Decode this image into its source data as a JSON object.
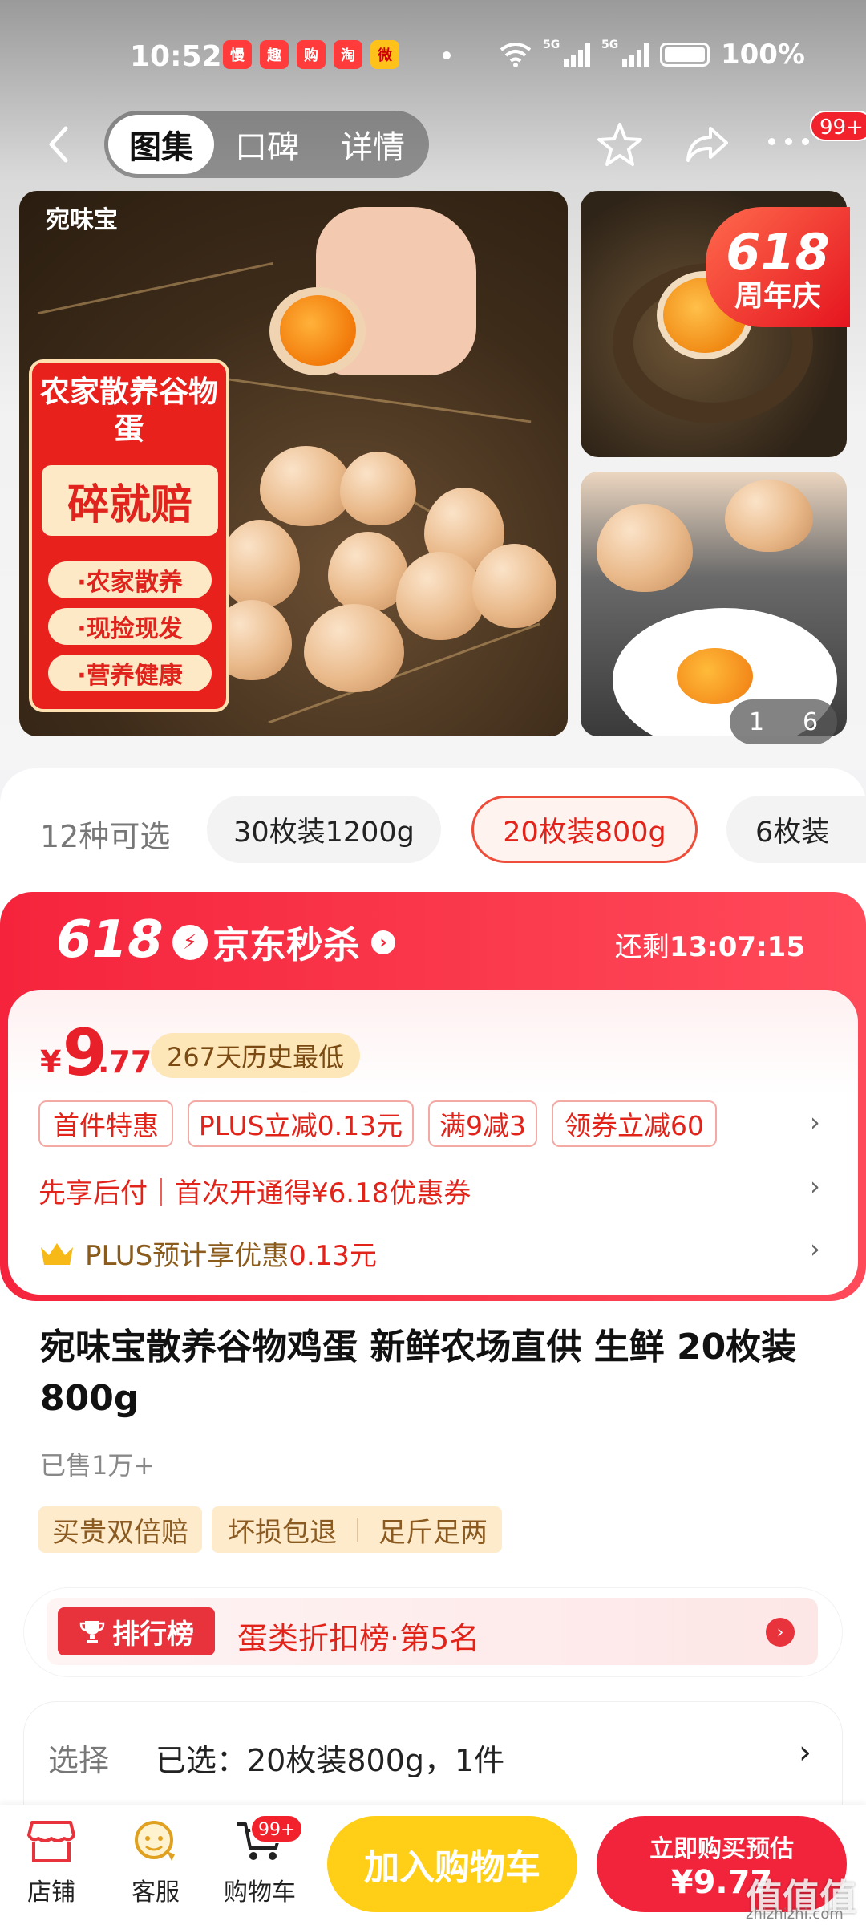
{
  "status_bar": {
    "time": "10:52",
    "battery": "100%",
    "network": "5G",
    "app_icons": [
      "慢",
      "趣",
      "购",
      "淘",
      "微"
    ]
  },
  "nav": {
    "tabs": [
      "图集",
      "口碑",
      "详情"
    ],
    "active_tab": 0,
    "more_badge": "99+"
  },
  "gallery": {
    "brand_logo": "宛味宝",
    "promo_title": "农家散养谷物蛋",
    "promo_big": "碎就赔",
    "promo_items": [
      "·农家散养",
      "·现捡现发",
      "·营养健康"
    ],
    "badge_618_number": "618",
    "badge_618_text": "周年庆",
    "page_current": "1",
    "page_total": "6"
  },
  "spec": {
    "label": "12种可选",
    "options": [
      "30枚装1200g",
      "20枚装800g",
      "6枚装"
    ],
    "selected_index": 1
  },
  "flash_sale": {
    "event": "618",
    "brand": "京东秒杀",
    "countdown_label": "还剩",
    "countdown": "13:07:15"
  },
  "price": {
    "currency": "¥",
    "integer": "9",
    "decimal": ".77",
    "history_low": "267天历史最低",
    "offer_tags": [
      "首件特惠",
      "PLUS立减0.13元",
      "满9减3",
      "领券立减60"
    ],
    "pay_later": "先享后付｜首次开通得¥6.18优惠券",
    "plus_text": "PLUS预计享优惠",
    "plus_amount": "0.13元"
  },
  "product": {
    "title": "宛味宝散养谷物鸡蛋 新鲜农场直供 生鲜 20枚装800g",
    "sold": "已售1万+",
    "service_tags": [
      "买贵双倍赔",
      "坏损包退",
      "足斤足两"
    ]
  },
  "ranking": {
    "badge": "排行榜",
    "text": "蛋类折扣榜·第5名"
  },
  "selection": {
    "label": "选择",
    "value": "已选：20枚装800g，1件"
  },
  "bottom_bar": {
    "store": "店铺",
    "service": "客服",
    "cart": "购物车",
    "cart_badge": "99+",
    "add_cart": "加入购物车",
    "buy_now_line1": "立即购买预估",
    "buy_now_line2": "¥9.77"
  },
  "watermark": {
    "text": "值值值",
    "url": "zhizhizhi.com"
  },
  "colors": {
    "accent_red": "#f2243c",
    "accent_yellow": "#ffcf17"
  }
}
